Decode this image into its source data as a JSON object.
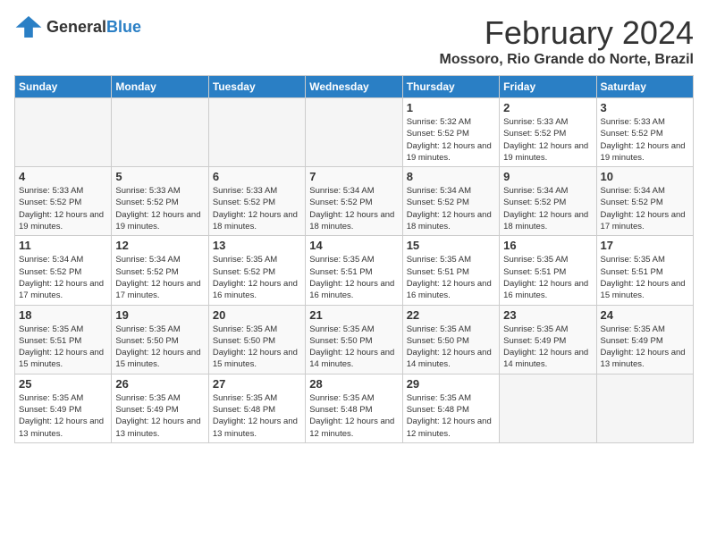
{
  "header": {
    "logo_general": "General",
    "logo_blue": "Blue",
    "month_year": "February 2024",
    "location": "Mossoro, Rio Grande do Norte, Brazil"
  },
  "weekdays": [
    "Sunday",
    "Monday",
    "Tuesday",
    "Wednesday",
    "Thursday",
    "Friday",
    "Saturday"
  ],
  "weeks": [
    [
      {
        "day": "",
        "empty": true
      },
      {
        "day": "",
        "empty": true
      },
      {
        "day": "",
        "empty": true
      },
      {
        "day": "",
        "empty": true
      },
      {
        "day": "1",
        "sunrise": "5:32 AM",
        "sunset": "5:52 PM",
        "daylight": "12 hours and 19 minutes."
      },
      {
        "day": "2",
        "sunrise": "5:33 AM",
        "sunset": "5:52 PM",
        "daylight": "12 hours and 19 minutes."
      },
      {
        "day": "3",
        "sunrise": "5:33 AM",
        "sunset": "5:52 PM",
        "daylight": "12 hours and 19 minutes."
      }
    ],
    [
      {
        "day": "4",
        "sunrise": "5:33 AM",
        "sunset": "5:52 PM",
        "daylight": "12 hours and 19 minutes."
      },
      {
        "day": "5",
        "sunrise": "5:33 AM",
        "sunset": "5:52 PM",
        "daylight": "12 hours and 19 minutes."
      },
      {
        "day": "6",
        "sunrise": "5:33 AM",
        "sunset": "5:52 PM",
        "daylight": "12 hours and 18 minutes."
      },
      {
        "day": "7",
        "sunrise": "5:34 AM",
        "sunset": "5:52 PM",
        "daylight": "12 hours and 18 minutes."
      },
      {
        "day": "8",
        "sunrise": "5:34 AM",
        "sunset": "5:52 PM",
        "daylight": "12 hours and 18 minutes."
      },
      {
        "day": "9",
        "sunrise": "5:34 AM",
        "sunset": "5:52 PM",
        "daylight": "12 hours and 18 minutes."
      },
      {
        "day": "10",
        "sunrise": "5:34 AM",
        "sunset": "5:52 PM",
        "daylight": "12 hours and 17 minutes."
      }
    ],
    [
      {
        "day": "11",
        "sunrise": "5:34 AM",
        "sunset": "5:52 PM",
        "daylight": "12 hours and 17 minutes."
      },
      {
        "day": "12",
        "sunrise": "5:34 AM",
        "sunset": "5:52 PM",
        "daylight": "12 hours and 17 minutes."
      },
      {
        "day": "13",
        "sunrise": "5:35 AM",
        "sunset": "5:52 PM",
        "daylight": "12 hours and 16 minutes."
      },
      {
        "day": "14",
        "sunrise": "5:35 AM",
        "sunset": "5:51 PM",
        "daylight": "12 hours and 16 minutes."
      },
      {
        "day": "15",
        "sunrise": "5:35 AM",
        "sunset": "5:51 PM",
        "daylight": "12 hours and 16 minutes."
      },
      {
        "day": "16",
        "sunrise": "5:35 AM",
        "sunset": "5:51 PM",
        "daylight": "12 hours and 16 minutes."
      },
      {
        "day": "17",
        "sunrise": "5:35 AM",
        "sunset": "5:51 PM",
        "daylight": "12 hours and 15 minutes."
      }
    ],
    [
      {
        "day": "18",
        "sunrise": "5:35 AM",
        "sunset": "5:51 PM",
        "daylight": "12 hours and 15 minutes."
      },
      {
        "day": "19",
        "sunrise": "5:35 AM",
        "sunset": "5:50 PM",
        "daylight": "12 hours and 15 minutes."
      },
      {
        "day": "20",
        "sunrise": "5:35 AM",
        "sunset": "5:50 PM",
        "daylight": "12 hours and 15 minutes."
      },
      {
        "day": "21",
        "sunrise": "5:35 AM",
        "sunset": "5:50 PM",
        "daylight": "12 hours and 14 minutes."
      },
      {
        "day": "22",
        "sunrise": "5:35 AM",
        "sunset": "5:50 PM",
        "daylight": "12 hours and 14 minutes."
      },
      {
        "day": "23",
        "sunrise": "5:35 AM",
        "sunset": "5:49 PM",
        "daylight": "12 hours and 14 minutes."
      },
      {
        "day": "24",
        "sunrise": "5:35 AM",
        "sunset": "5:49 PM",
        "daylight": "12 hours and 13 minutes."
      }
    ],
    [
      {
        "day": "25",
        "sunrise": "5:35 AM",
        "sunset": "5:49 PM",
        "daylight": "12 hours and 13 minutes."
      },
      {
        "day": "26",
        "sunrise": "5:35 AM",
        "sunset": "5:49 PM",
        "daylight": "12 hours and 13 minutes."
      },
      {
        "day": "27",
        "sunrise": "5:35 AM",
        "sunset": "5:48 PM",
        "daylight": "12 hours and 13 minutes."
      },
      {
        "day": "28",
        "sunrise": "5:35 AM",
        "sunset": "5:48 PM",
        "daylight": "12 hours and 12 minutes."
      },
      {
        "day": "29",
        "sunrise": "5:35 AM",
        "sunset": "5:48 PM",
        "daylight": "12 hours and 12 minutes."
      },
      {
        "day": "",
        "empty": true
      },
      {
        "day": "",
        "empty": true
      }
    ]
  ],
  "labels": {
    "sunrise": "Sunrise:",
    "sunset": "Sunset:",
    "daylight": "Daylight hours"
  }
}
